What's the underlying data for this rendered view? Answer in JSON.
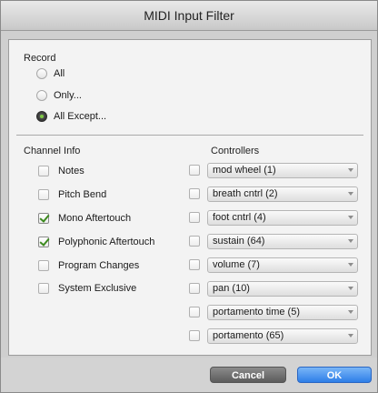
{
  "window": {
    "title": "MIDI Input Filter"
  },
  "record": {
    "label": "Record",
    "options": [
      {
        "label": "All",
        "selected": false
      },
      {
        "label": "Only...",
        "selected": false
      },
      {
        "label": "All Except...",
        "selected": true
      }
    ]
  },
  "channel_info": {
    "label": "Channel Info",
    "items": [
      {
        "label": "Notes",
        "checked": false
      },
      {
        "label": "Pitch Bend",
        "checked": false
      },
      {
        "label": "Mono Aftertouch",
        "checked": true
      },
      {
        "label": "Polyphonic Aftertouch",
        "checked": true
      },
      {
        "label": "Program Changes",
        "checked": false
      },
      {
        "label": "System Exclusive",
        "checked": false
      }
    ]
  },
  "controllers": {
    "label": "Controllers",
    "items": [
      {
        "value": "mod wheel (1)",
        "checked": false
      },
      {
        "value": "breath cntrl (2)",
        "checked": false
      },
      {
        "value": "foot cntrl (4)",
        "checked": false
      },
      {
        "value": "sustain (64)",
        "checked": false
      },
      {
        "value": "volume (7)",
        "checked": false
      },
      {
        "value": "pan (10)",
        "checked": false
      },
      {
        "value": "portamento time (5)",
        "checked": false
      },
      {
        "value": "portamento (65)",
        "checked": false
      }
    ]
  },
  "buttons": {
    "cancel": "Cancel",
    "ok": "OK"
  },
  "colors": {
    "ok_button": "#2e7ee8",
    "cancel_button": "#5c5c5c",
    "checkmark": "#3c8a1e",
    "radio_dot": "#7ec845"
  }
}
